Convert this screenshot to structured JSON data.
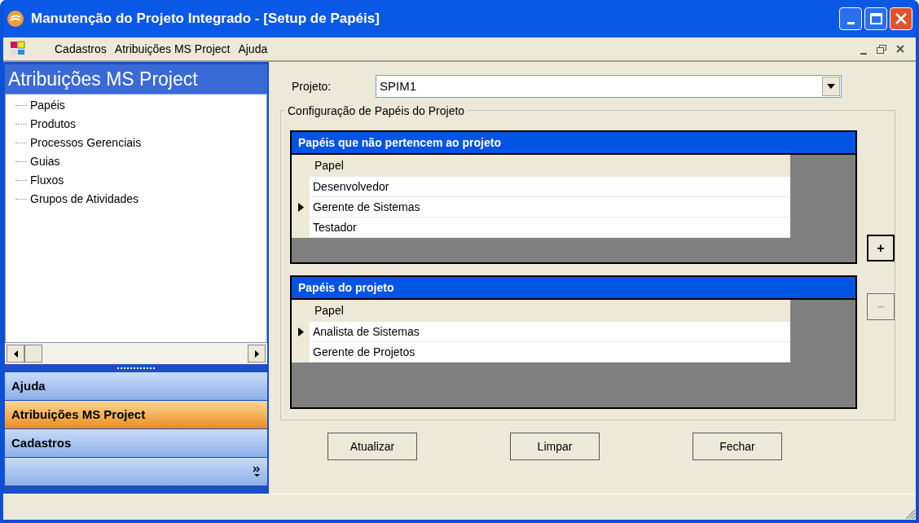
{
  "window": {
    "title": "Manutenção do Projeto Integrado - [Setup de Papéis]"
  },
  "menu": [
    "Cadastros",
    "Atribuições MS Project",
    "Ajuda"
  ],
  "sidebar": {
    "title": "Atribuições MS Project",
    "tree": [
      "Papéis",
      "Produtos",
      "Processos Gerenciais",
      "Guias",
      "Fluxos",
      "Grupos de Atividades"
    ],
    "nav": [
      {
        "label": "Ajuda",
        "selected": false
      },
      {
        "label": "Atribuições MS Project",
        "selected": true
      },
      {
        "label": "Cadastros",
        "selected": false
      }
    ]
  },
  "project": {
    "label": "Projeto:",
    "value": "SPIM1"
  },
  "group": {
    "title": "Configuração de Papéis do Projeto"
  },
  "grids": [
    {
      "title": "Papéis que não pertencem ao projeto",
      "column": "Papel",
      "rows": [
        {
          "text": "Desenvolvedor",
          "current": false
        },
        {
          "text": "Gerente de Sistemas",
          "current": true
        },
        {
          "text": "Testador",
          "current": false
        }
      ],
      "button": {
        "label": "+",
        "disabled": false
      }
    },
    {
      "title": "Papéis do projeto",
      "column": "Papel",
      "rows": [
        {
          "text": "Analista de Sistemas",
          "current": true
        },
        {
          "text": "Gerente de Projetos",
          "current": false
        }
      ],
      "button": {
        "label": "−",
        "disabled": true
      }
    }
  ],
  "buttons": [
    "Atualizar",
    "Limpar",
    "Fechar"
  ]
}
